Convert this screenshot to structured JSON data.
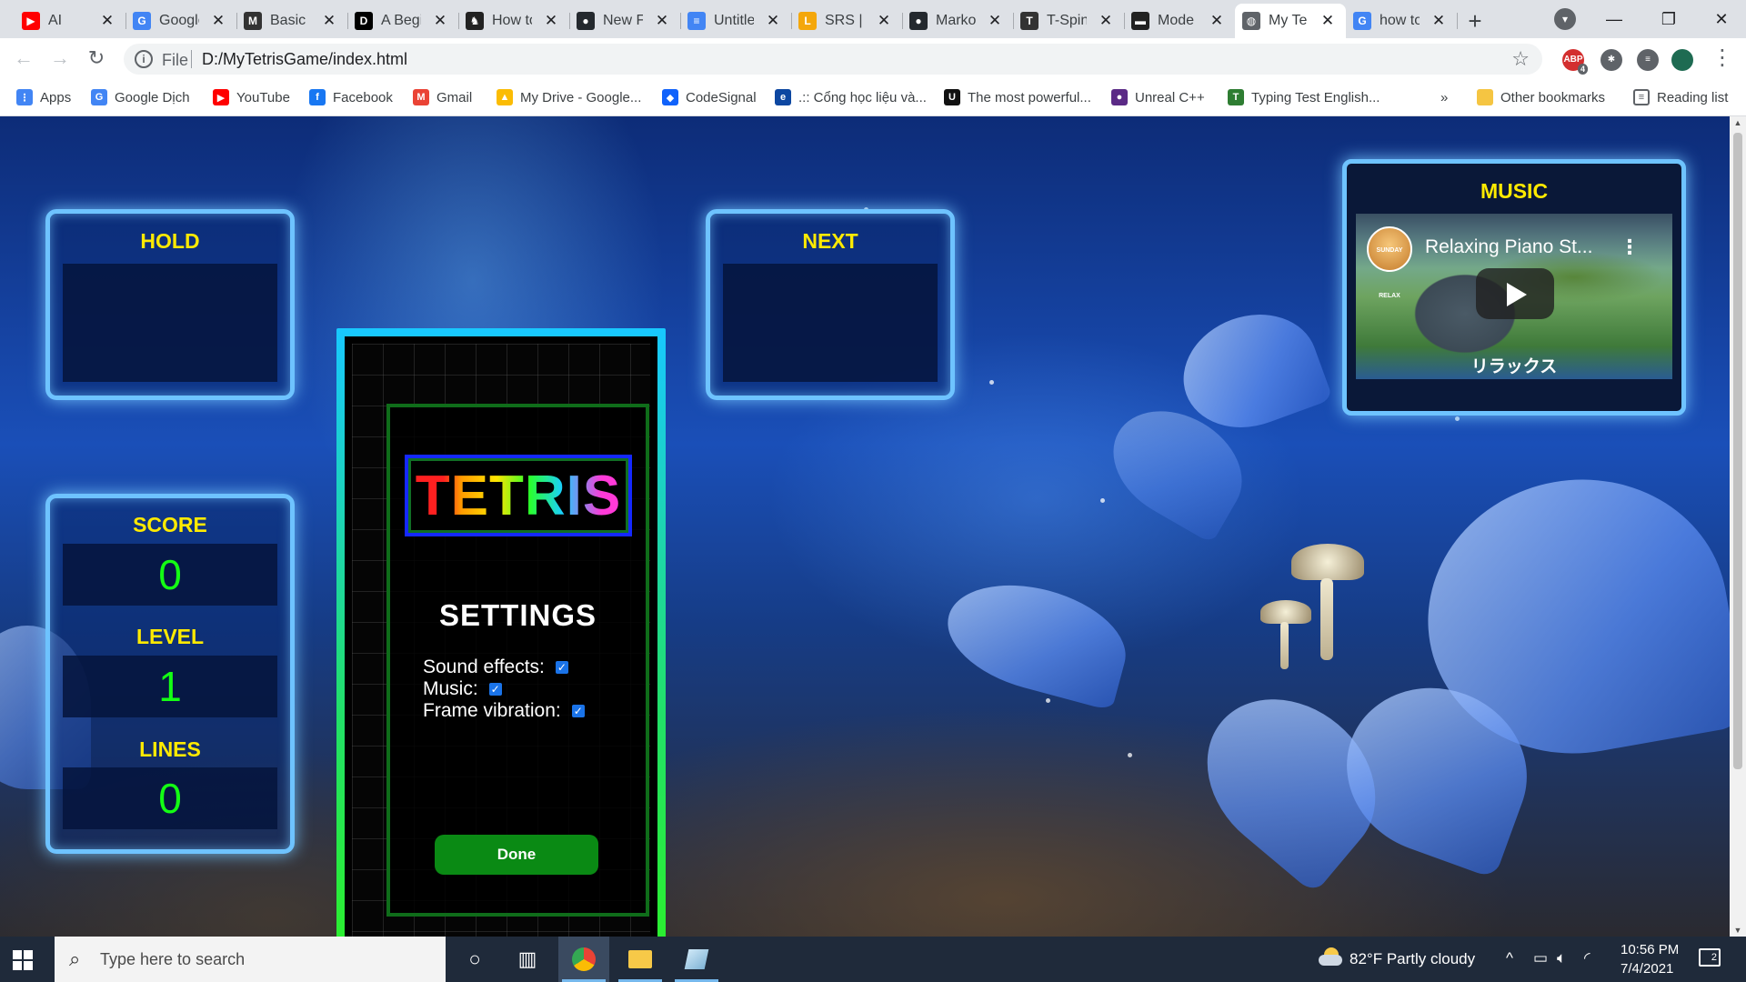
{
  "browser": {
    "tabs": [
      {
        "title": "AI",
        "favicon": "youtube-icon",
        "color": "#ff0000",
        "glyph": "▶"
      },
      {
        "title": "Google",
        "favicon": "google-translate-icon",
        "color": "#4285f4",
        "glyph": "G"
      },
      {
        "title": "Basic S",
        "favicon": "md-icon",
        "color": "#333333",
        "glyph": "M"
      },
      {
        "title": "A Begi",
        "favicon": "dev-icon",
        "color": "#000000",
        "glyph": "D"
      },
      {
        "title": "How to",
        "favicon": "horse-icon",
        "color": "#222222",
        "glyph": "♞"
      },
      {
        "title": "New F",
        "favicon": "github-icon",
        "color": "#24292e",
        "glyph": "●"
      },
      {
        "title": "Untitle",
        "favicon": "docs-icon",
        "color": "#4285f4",
        "glyph": "≡"
      },
      {
        "title": "SRS | T",
        "favicon": "srs-icon",
        "color": "#f4a70b",
        "glyph": "L"
      },
      {
        "title": "Marko",
        "favicon": "github-icon",
        "color": "#24292e",
        "glyph": "●"
      },
      {
        "title": "T-Spin",
        "favicon": "tspin-icon",
        "color": "#333333",
        "glyph": "T"
      },
      {
        "title": "Mode",
        "favicon": "film-icon",
        "color": "#222222",
        "glyph": "▬"
      },
      {
        "title": "My Te",
        "favicon": "globe-icon",
        "color": "#5f6368",
        "glyph": "◍"
      },
      {
        "title": "how to",
        "favicon": "google-icon",
        "color": "#4285f4",
        "glyph": "G"
      }
    ],
    "active_tab": 11,
    "new_tab_label": "+",
    "address": {
      "scheme": "File",
      "url": "D:/MyTetrisGame/index.html"
    },
    "extensions": [
      {
        "label": "ABP",
        "badge": "4",
        "color": "#d32f2f"
      },
      {
        "label": "✱",
        "color": "#5f6368"
      },
      {
        "label": "≡",
        "color": "#5f6368"
      },
      {
        "label": "",
        "color": "#1e6b52"
      }
    ]
  },
  "bookmarks": {
    "items": [
      {
        "label": "Apps",
        "icon": "apps-grid-icon",
        "color": "#4285f4",
        "glyph": "⋮"
      },
      {
        "label": "Google Dịch",
        "icon": "google-translate-icon",
        "color": "#4285f4",
        "glyph": "G"
      },
      {
        "label": "YouTube",
        "icon": "youtube-icon",
        "color": "#ff0000",
        "glyph": "▶"
      },
      {
        "label": "Facebook",
        "icon": "facebook-icon",
        "color": "#1877f2",
        "glyph": "f"
      },
      {
        "label": "Gmail",
        "icon": "gmail-icon",
        "color": "#ea4335",
        "glyph": "M"
      },
      {
        "label": "My Drive - Google...",
        "icon": "drive-icon",
        "color": "#fbbc04",
        "glyph": "▲"
      },
      {
        "label": "CodeSignal",
        "icon": "codesignal-icon",
        "color": "#1062fb",
        "glyph": "◆"
      },
      {
        "label": ".:: Cổng học liệu và...",
        "icon": "edu-icon",
        "color": "#0d47a1",
        "glyph": "e"
      },
      {
        "label": "The most powerful...",
        "icon": "unreal-icon",
        "color": "#111111",
        "glyph": "U"
      },
      {
        "label": "Unreal C++",
        "icon": "unreal-cpp-icon",
        "color": "#5b2a86",
        "glyph": "●"
      },
      {
        "label": "Typing Test English...",
        "icon": "typing-icon",
        "color": "#2e7d32",
        "glyph": "T"
      }
    ],
    "overflow": "»",
    "other_bookmarks": "Other bookmarks",
    "reading_list": "Reading list"
  },
  "game": {
    "hold_title": "HOLD",
    "next_title": "NEXT",
    "score_title": "SCORE",
    "score": "0",
    "level_title": "LEVEL",
    "level": "1",
    "lines_title": "LINES",
    "lines": "0",
    "logo": "TETRIS",
    "settings_title": "SETTINGS",
    "options": [
      {
        "label": "Sound effects:",
        "checked": true
      },
      {
        "label": "Music:",
        "checked": true
      },
      {
        "label": "Frame vibration:",
        "checked": true
      }
    ],
    "done_label": "Done",
    "music_title": "MUSIC",
    "video_title": "Relaxing Piano St...",
    "video_caption": "リラックス",
    "channel_badge": "SUNDAY RELAX"
  },
  "taskbar": {
    "search_placeholder": "Type here to search",
    "weather": "82°F  Partly cloudy",
    "time": "10:56 PM",
    "date": "7/4/2021",
    "notification_count": "2"
  }
}
